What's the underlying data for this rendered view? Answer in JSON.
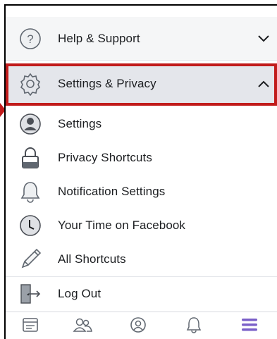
{
  "menu": {
    "help": {
      "label": "Help & Support",
      "icon": "question-icon",
      "chevron": "chevron-down-icon"
    },
    "settings_privacy": {
      "label": "Settings & Privacy",
      "icon": "gear-icon",
      "chevron": "chevron-up-icon",
      "expanded": true
    },
    "sub_items": [
      {
        "label": "Settings",
        "icon": "account-icon"
      },
      {
        "label": "Privacy Shortcuts",
        "icon": "lock-icon"
      },
      {
        "label": "Notification Settings",
        "icon": "bell-icon"
      },
      {
        "label": "Your Time on Facebook",
        "icon": "clock-icon"
      },
      {
        "label": "All Shortcuts",
        "icon": "pencil-icon"
      }
    ],
    "logout": {
      "label": "Log Out",
      "icon": "logout-icon"
    }
  },
  "tabbar": {
    "tabs": [
      {
        "name": "news-feed",
        "icon": "news-feed-icon",
        "active": false
      },
      {
        "name": "friends",
        "icon": "friends-icon",
        "active": false
      },
      {
        "name": "profile",
        "icon": "profile-icon",
        "active": false
      },
      {
        "name": "notifications",
        "icon": "bell-outline-icon",
        "active": false
      },
      {
        "name": "menu",
        "icon": "hamburger-menu-icon",
        "active": true
      }
    ]
  },
  "colors": {
    "highlight_border": "#c11b1b",
    "active_tab": "#7a5fc8",
    "icon_gray": "#606770"
  }
}
